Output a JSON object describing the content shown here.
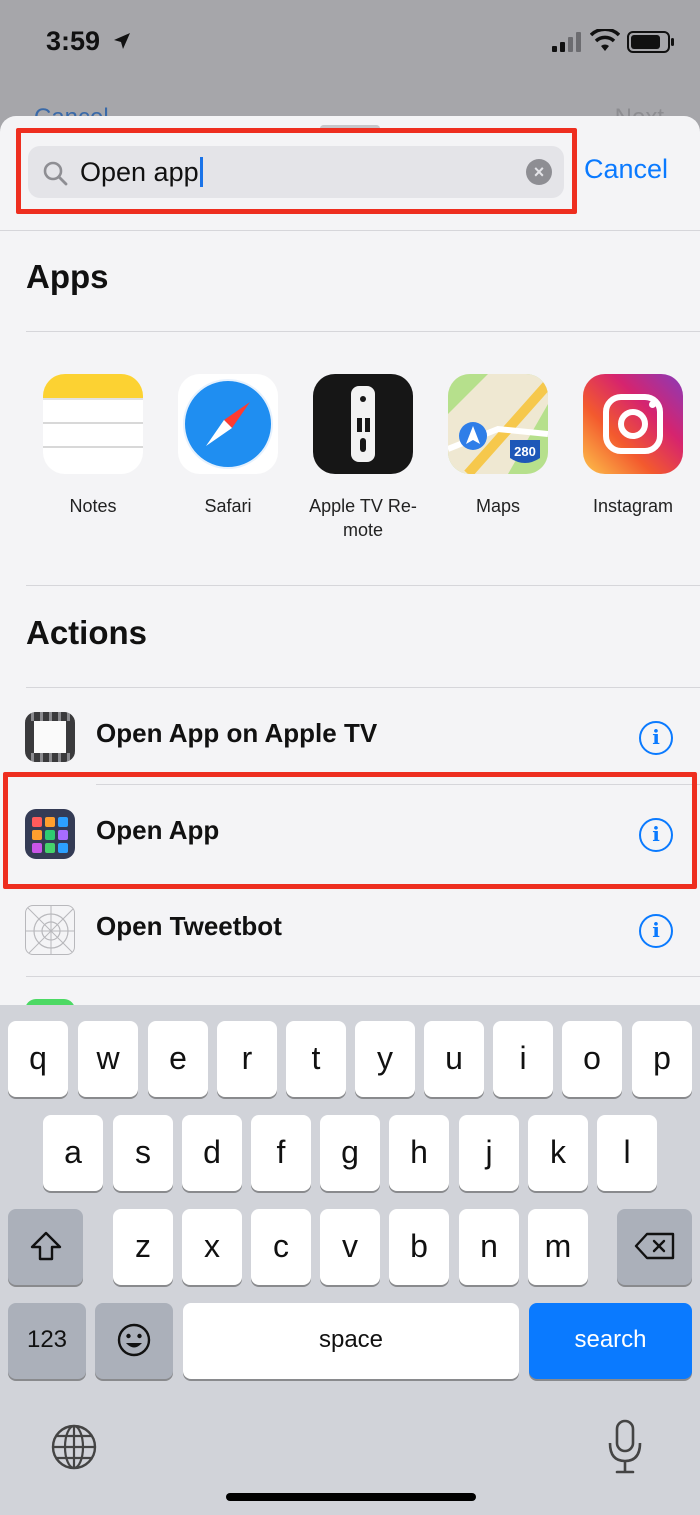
{
  "status": {
    "time": "3:59"
  },
  "background": {
    "left_button": "Cancel",
    "right_button": "Next"
  },
  "search": {
    "value": "Open app",
    "cancel_label": "Cancel"
  },
  "apps": {
    "title": "Apps",
    "items": [
      {
        "label": "Notes",
        "icon": "notes-icon"
      },
      {
        "label": "Safari",
        "icon": "safari-icon"
      },
      {
        "label": "Apple TV Re-\nmote",
        "icon": "apple-tv-remote-icon"
      },
      {
        "label": "Maps",
        "icon": "maps-icon"
      },
      {
        "label": "Instagram",
        "icon": "instagram-icon"
      }
    ]
  },
  "actions": {
    "title": "Actions",
    "items": [
      {
        "label": "Open App on Apple TV",
        "icon": "apple-tv-grid-icon"
      },
      {
        "label": "Open App",
        "icon": "app-grid-icon"
      },
      {
        "label": "Open Tweetbot",
        "icon": "tweetbot-icon"
      }
    ]
  },
  "maps_badge": "280",
  "keyboard": {
    "row1": [
      "q",
      "w",
      "e",
      "r",
      "t",
      "y",
      "u",
      "i",
      "o",
      "p"
    ],
    "row2": [
      "a",
      "s",
      "d",
      "f",
      "g",
      "h",
      "j",
      "k",
      "l"
    ],
    "row3": [
      "z",
      "x",
      "c",
      "v",
      "b",
      "n",
      "m"
    ],
    "numbers_key": "123",
    "space_key": "space",
    "search_key": "search"
  },
  "colors": {
    "accent": "#0a7aff",
    "highlight": "#ee2e1f"
  }
}
